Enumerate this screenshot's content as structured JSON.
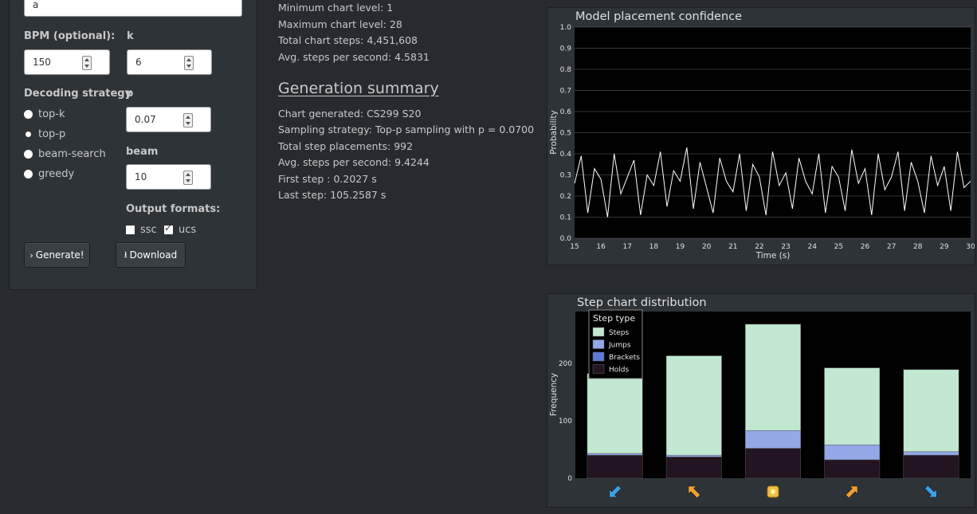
{
  "form": {
    "name_value": "a",
    "bpm_label": "BPM (optional):",
    "bpm_value": "150",
    "k_label": "k",
    "k_value": "6",
    "decoding_label": "Decoding strategy",
    "p_label": "p",
    "p_value": "0.07",
    "beam_label": "beam",
    "beam_value": "10",
    "strategies": [
      {
        "label": "top-k",
        "selected": false
      },
      {
        "label": "top-p",
        "selected": true
      },
      {
        "label": "beam-search",
        "selected": false
      },
      {
        "label": "greedy",
        "selected": false
      }
    ],
    "output_label": "Output formats:",
    "formats": [
      {
        "label": "ssc",
        "checked": false
      },
      {
        "label": "ucs",
        "checked": true
      }
    ],
    "generate_label": "Generate!",
    "download_label": "Download"
  },
  "stats": {
    "lines": [
      "Minimum chart level: 1",
      "Maximum chart level: 28",
      "Total chart steps: 4,451,608",
      "Avg. steps per second: 4.5831"
    ]
  },
  "summary": {
    "title": "Generation summary",
    "lines": [
      "Chart generated: CS299 S20",
      "Sampling strategy: Top-p sampling with p = 0.0700",
      "Total step placements: 992",
      "Avg. steps per second: 9.4244",
      "First step : 0.2027 s",
      "Last step: 105.2587 s"
    ]
  },
  "colors": {
    "page_bg": "#272b30",
    "panel_bg": "#2e3338",
    "steps": "#c2e8d2",
    "jumps": "#94a8e8",
    "brackets": "#5f7ad8",
    "holds": "#221420",
    "arrow_blue": "#3aa0e8",
    "arrow_orange": "#f0a030",
    "center_yellow": "#f2c040"
  },
  "chart_data": [
    {
      "type": "line",
      "title": "Model placement confidence",
      "xlabel": "Time (s)",
      "ylabel": "Probability",
      "xlim": [
        15,
        30
      ],
      "ylim": [
        0.0,
        1.0
      ],
      "xticks": [
        15,
        16,
        17,
        18,
        19,
        20,
        21,
        22,
        23,
        24,
        25,
        26,
        27,
        28,
        29,
        30
      ],
      "yticks": [
        0.0,
        0.1,
        0.2,
        0.3,
        0.4,
        0.5,
        0.6,
        0.7,
        0.8,
        0.9,
        1.0
      ],
      "grid": true,
      "series": [
        {
          "name": "",
          "x": [
            15,
            15.25,
            15.5,
            15.75,
            16,
            16.25,
            16.5,
            16.75,
            17,
            17.25,
            17.5,
            17.75,
            18,
            18.25,
            18.5,
            18.75,
            19,
            19.25,
            19.5,
            19.75,
            20,
            20.25,
            20.5,
            20.75,
            21,
            21.25,
            21.5,
            21.75,
            22,
            22.25,
            22.5,
            22.75,
            23,
            23.25,
            23.5,
            23.75,
            24,
            24.25,
            24.5,
            24.75,
            25,
            25.25,
            25.5,
            25.75,
            26,
            26.25,
            26.5,
            26.75,
            27,
            27.25,
            27.5,
            27.75,
            28,
            28.25,
            28.5,
            28.75,
            29,
            29.25,
            29.5,
            29.75,
            30
          ],
          "y": [
            0.26,
            0.39,
            0.12,
            0.33,
            0.28,
            0.1,
            0.4,
            0.21,
            0.29,
            0.37,
            0.11,
            0.3,
            0.25,
            0.41,
            0.15,
            0.32,
            0.27,
            0.43,
            0.14,
            0.36,
            0.24,
            0.12,
            0.38,
            0.27,
            0.22,
            0.4,
            0.13,
            0.35,
            0.29,
            0.11,
            0.41,
            0.25,
            0.31,
            0.14,
            0.38,
            0.27,
            0.21,
            0.4,
            0.12,
            0.34,
            0.29,
            0.13,
            0.42,
            0.26,
            0.33,
            0.11,
            0.4,
            0.23,
            0.29,
            0.41,
            0.13,
            0.36,
            0.27,
            0.12,
            0.39,
            0.25,
            0.34,
            0.13,
            0.41,
            0.24,
            0.27
          ]
        }
      ]
    },
    {
      "type": "bar",
      "title": "Step chart distribution",
      "xlabel": "",
      "ylabel": "Frequency",
      "ylim": [
        0,
        290
      ],
      "yticks": [
        0,
        100,
        200
      ],
      "categories": [
        "down-left",
        "up-left",
        "center",
        "up-right",
        "down-right"
      ],
      "legend_title": "Step type",
      "legend_position": "top-left",
      "series": [
        {
          "name": "Holds",
          "values": [
            40,
            37,
            52,
            32,
            40
          ]
        },
        {
          "name": "Brackets",
          "values": [
            0,
            0,
            0,
            0,
            0
          ]
        },
        {
          "name": "Jumps",
          "values": [
            3,
            3,
            31,
            26,
            6
          ]
        },
        {
          "name": "Steps",
          "values": [
            139,
            173,
            185,
            134,
            143
          ]
        }
      ]
    }
  ]
}
